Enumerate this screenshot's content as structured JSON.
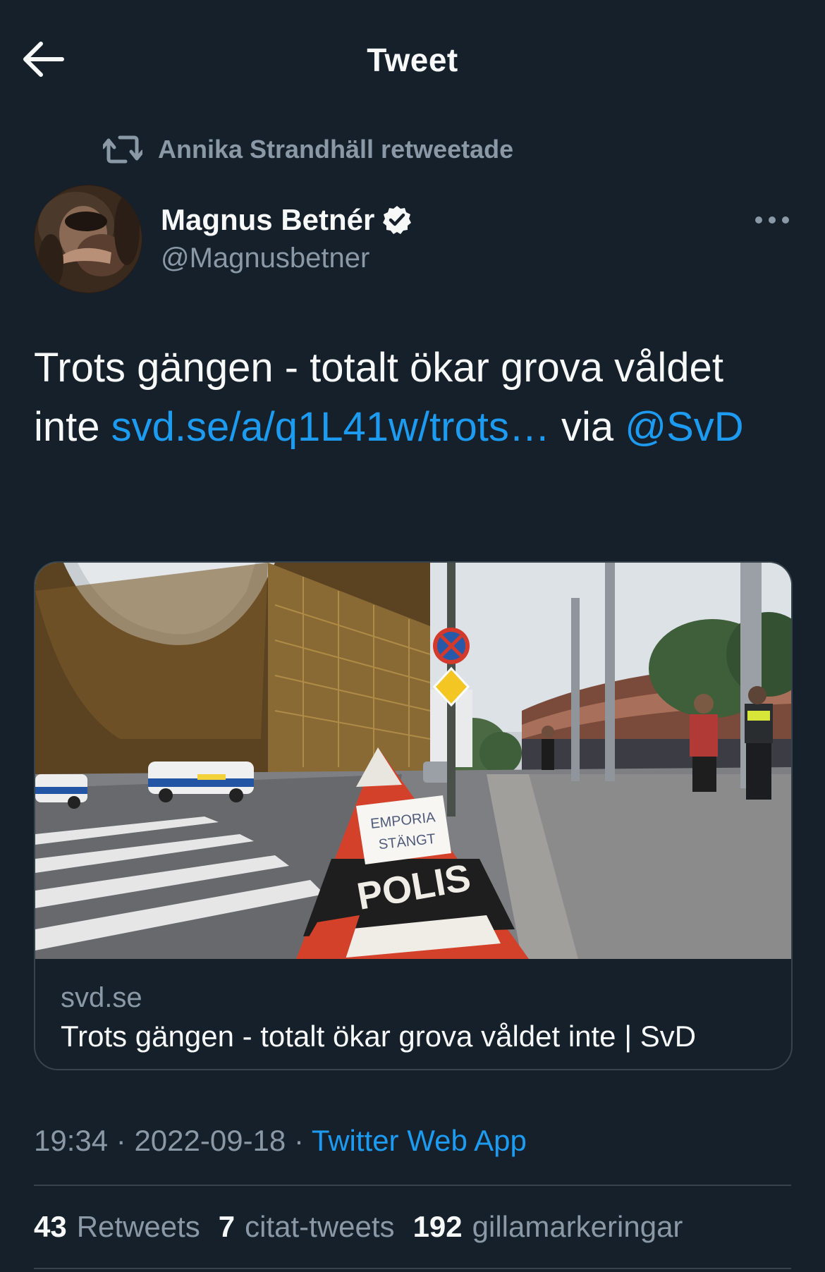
{
  "header": {
    "title": "Tweet",
    "back_icon": "arrow-left-icon"
  },
  "retweet_context": {
    "icon": "retweet-icon",
    "text": "Annika Strandhäll retweetade"
  },
  "author": {
    "name": "Magnus Betnér",
    "handle": "@Magnusbetner",
    "verified_icon": "verified-badge-icon"
  },
  "tweet": {
    "text_part1": "Trots gängen - totalt ökar grova våldet inte ",
    "link_text": "svd.se/a/q1L41w/trots…",
    "text_part2": " via ",
    "mention": "@SvD"
  },
  "card": {
    "image_sign_text": "EMPORIA STÄNGT",
    "image_cone_text": "POLIS",
    "domain": "svd.se",
    "title": "Trots gängen - totalt ökar grova våldet inte | SvD"
  },
  "meta": {
    "time": "19:34",
    "separator": " · ",
    "date": "2022-09-18",
    "source": "Twitter Web App"
  },
  "stats": {
    "retweets_count": "43",
    "retweets_label": "Retweets",
    "quotes_count": "7",
    "quotes_label": "citat-tweets",
    "likes_count": "192",
    "likes_label": "gillamarkeringar"
  },
  "colors": {
    "background": "#15202b",
    "text": "#f7f9f9",
    "secondary": "#8b98a5",
    "link": "#1d9bf0",
    "border": "#38444d"
  }
}
